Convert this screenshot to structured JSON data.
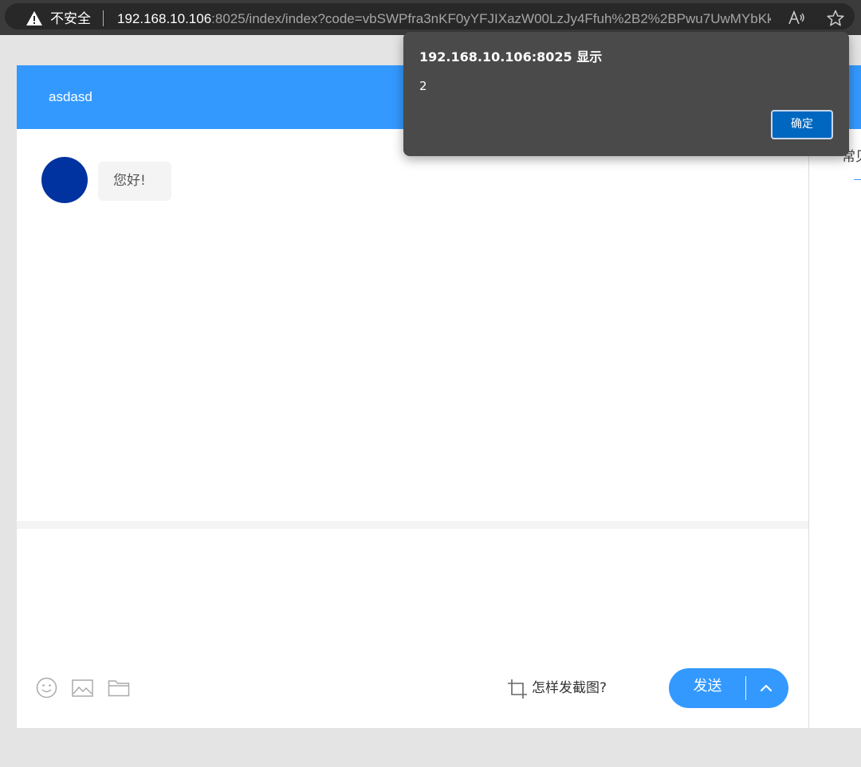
{
  "browser": {
    "security_label": "不安全",
    "url_host": "192.168.10.106",
    "url_rest": ":8025/index/index?code=vbSWPfra3nKF0yYFJIXazW00LzJy4Ffuh%2B2%2BPwu7UwMYbKk..."
  },
  "chat": {
    "title": "asdasd",
    "messages": [
      {
        "text": "您好!"
      }
    ],
    "side_text": "常见"
  },
  "toolbar": {
    "screenshot_help": "怎样发截图?",
    "send_label": "发送"
  },
  "alert": {
    "title": "192.168.10.106:8025 显示",
    "message": "2",
    "ok_label": "确定"
  },
  "colors": {
    "accent": "#3399ff",
    "avatar": "#0033a0",
    "dialog_bg": "#4a4a4a",
    "dialog_button": "#0067c0"
  }
}
